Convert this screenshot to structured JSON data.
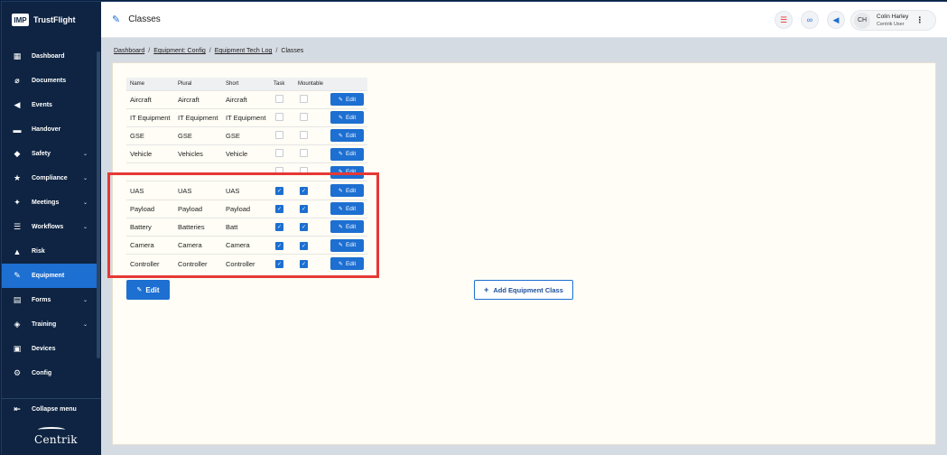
{
  "app": {
    "logo_mark": "IMP",
    "logo_text": "TrustFlight",
    "brand": "Centrik"
  },
  "sidebar": {
    "items": [
      {
        "label": "Dashboard",
        "icon": "dashboard-icon",
        "glyph": "▦",
        "chevron": false,
        "active": false
      },
      {
        "label": "Documents",
        "icon": "paperclip-icon",
        "glyph": "⌀",
        "chevron": false,
        "active": false
      },
      {
        "label": "Events",
        "icon": "megaphone-icon",
        "glyph": "◀",
        "chevron": false,
        "active": false
      },
      {
        "label": "Handover",
        "icon": "handover-icon",
        "glyph": "▬",
        "chevron": false,
        "active": false
      },
      {
        "label": "Safety",
        "icon": "shield-icon",
        "glyph": "◆",
        "chevron": true,
        "active": false
      },
      {
        "label": "Compliance",
        "icon": "compliance-icon",
        "glyph": "★",
        "chevron": true,
        "active": false
      },
      {
        "label": "Meetings",
        "icon": "meetings-icon",
        "glyph": "✦",
        "chevron": true,
        "active": false
      },
      {
        "label": "Workflows",
        "icon": "workflows-icon",
        "glyph": "☰",
        "chevron": true,
        "active": false
      },
      {
        "label": "Risk",
        "icon": "risk-icon",
        "glyph": "▲",
        "chevron": false,
        "active": false
      },
      {
        "label": "Equipment",
        "icon": "wrench-icon",
        "glyph": "✎",
        "chevron": false,
        "active": true
      },
      {
        "label": "Forms",
        "icon": "forms-icon",
        "glyph": "▤",
        "chevron": true,
        "active": false
      },
      {
        "label": "Training",
        "icon": "graduation-cap-icon",
        "glyph": "◈",
        "chevron": true,
        "active": false
      },
      {
        "label": "Devices",
        "icon": "devices-icon",
        "glyph": "▣",
        "chevron": false,
        "active": false
      },
      {
        "label": "Config",
        "icon": "config-icon",
        "glyph": "⚙",
        "chevron": false,
        "active": false
      }
    ],
    "collapse_label": "Collapse menu",
    "chevron_glyph": "⌄"
  },
  "header": {
    "title": "Classes",
    "user": {
      "initials": "CH",
      "name": "Colin Harley",
      "role": "Centrik User"
    }
  },
  "breadcrumb": {
    "items": [
      "Dashboard",
      "Equipment: Config",
      "Equipment Tech Log"
    ],
    "current": "Classes",
    "separator": "/"
  },
  "table": {
    "headers": {
      "name": "Name",
      "plural": "Plural",
      "short": "Short",
      "task": "Task",
      "mountable": "Mountable"
    },
    "edit_label": "Edit",
    "rows": [
      {
        "name": "Aircraft",
        "plural": "Aircraft",
        "short": "Aircraft",
        "task": false,
        "mountable": false
      },
      {
        "name": "IT Equipment",
        "plural": "IT Equipment",
        "short": "IT Equipment",
        "task": false,
        "mountable": false
      },
      {
        "name": "GSE",
        "plural": "GSE",
        "short": "GSE",
        "task": false,
        "mountable": false
      },
      {
        "name": "Vehicle",
        "plural": "Vehicles",
        "short": "Vehicle",
        "task": false,
        "mountable": false
      },
      {
        "name": "",
        "plural": "",
        "short": "",
        "task": false,
        "mountable": false
      },
      {
        "name": "UAS",
        "plural": "UAS",
        "short": "UAS",
        "task": true,
        "mountable": true
      },
      {
        "name": "Payload",
        "plural": "Payload",
        "short": "Payload",
        "task": true,
        "mountable": true
      },
      {
        "name": "Battery",
        "plural": "Batteries",
        "short": "Batt",
        "task": true,
        "mountable": true
      },
      {
        "name": "Camera",
        "plural": "Camera",
        "short": "Camera",
        "task": true,
        "mountable": true
      },
      {
        "name": "Controller",
        "plural": "Controller",
        "short": "Controller",
        "task": true,
        "mountable": true
      }
    ]
  },
  "actions": {
    "edit_label": "Edit",
    "add_label": "Add Equipment Class"
  },
  "colors": {
    "accent": "#1d6fd1",
    "sidebar": "#0e2442",
    "highlight": "#e53935"
  }
}
